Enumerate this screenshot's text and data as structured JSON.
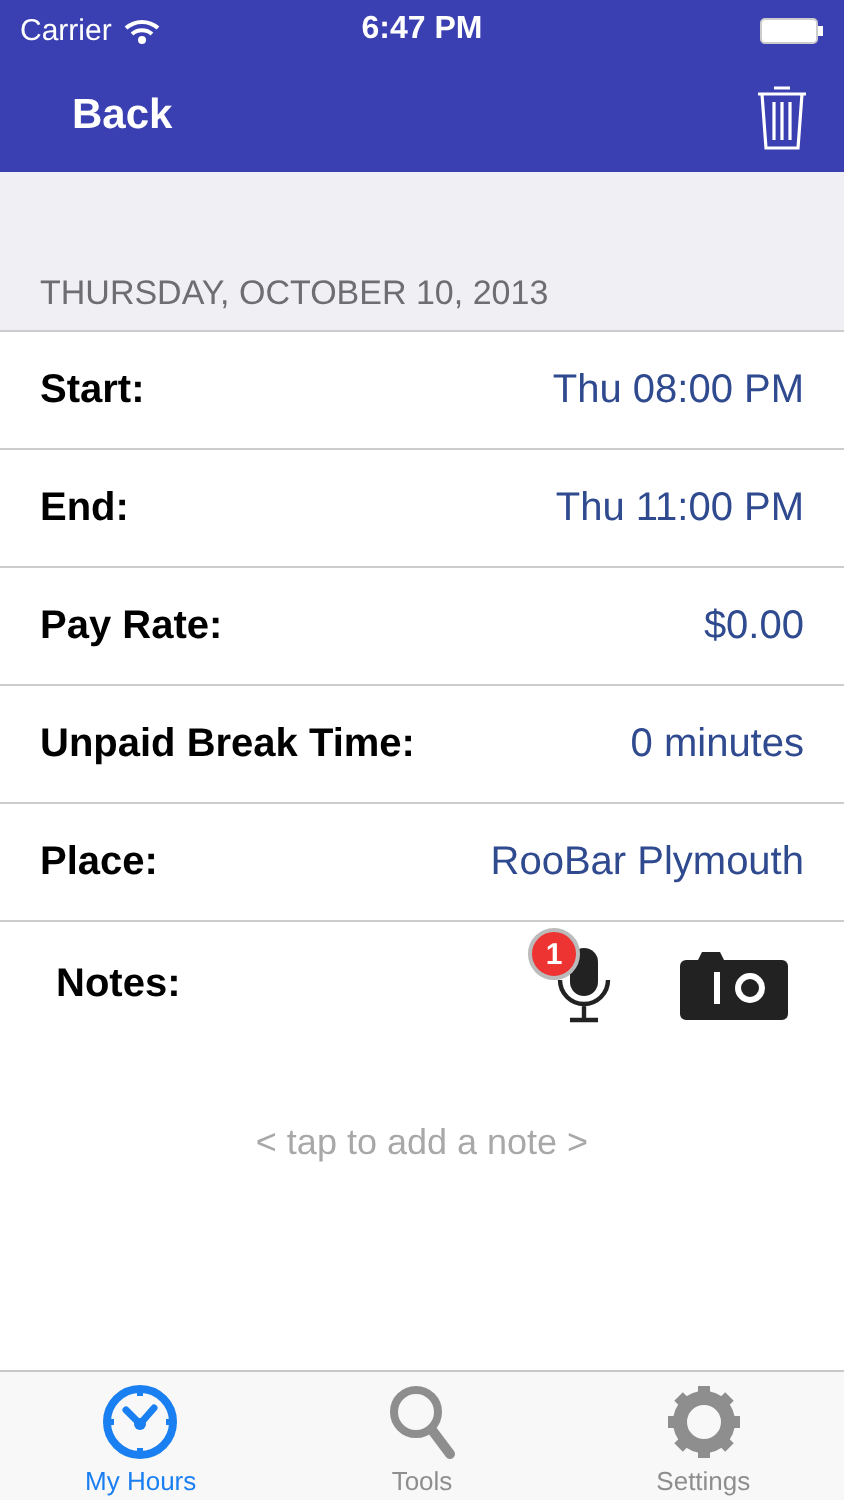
{
  "status_bar": {
    "carrier": "Carrier",
    "time": "6:47 PM"
  },
  "nav": {
    "back": "Back"
  },
  "date_header": "THURSDAY, OCTOBER 10, 2013",
  "rows": [
    {
      "label": "Start:",
      "value": "Thu 08:00 PM"
    },
    {
      "label": "End:",
      "value": "Thu 11:00 PM"
    },
    {
      "label": "Pay Rate:",
      "value": "$0.00"
    },
    {
      "label": "Unpaid Break Time:",
      "value": "0 minutes"
    },
    {
      "label": "Place:",
      "value": "RooBar Plymouth"
    }
  ],
  "notes": {
    "label": "Notes:",
    "voice_badge": "1",
    "placeholder": "< tap to add a note >"
  },
  "tabs": [
    {
      "label": "My Hours",
      "kind": "clock",
      "selected": true
    },
    {
      "label": "Tools",
      "kind": "search",
      "selected": false
    },
    {
      "label": "Settings",
      "kind": "gear",
      "selected": false
    }
  ]
}
